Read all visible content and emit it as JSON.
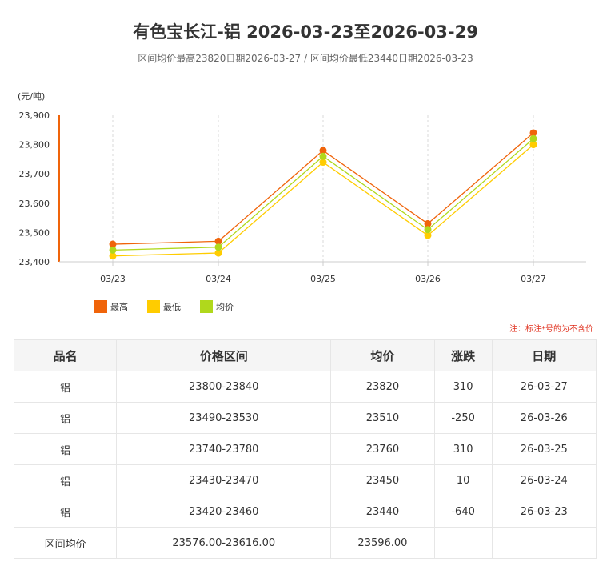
{
  "header": {
    "title": "有色宝长江-铝 2026-03-23至2026-03-29",
    "subtitle": "区间均价最高23820日期2026-03-27 / 区间均价最低23440日期2026-03-23"
  },
  "chart_data": {
    "type": "line",
    "categories": [
      "03/23",
      "03/24",
      "03/25",
      "03/26",
      "03/27"
    ],
    "series": [
      {
        "name": "最高",
        "color": "#f0640a",
        "values": [
          23460,
          23470,
          23780,
          23530,
          23840
        ]
      },
      {
        "name": "最低",
        "color": "#ffcc00",
        "values": [
          23420,
          23430,
          23740,
          23490,
          23800
        ]
      },
      {
        "name": "均价",
        "color": "#b0d81c",
        "values": [
          23440,
          23450,
          23760,
          23510,
          23820
        ]
      }
    ],
    "yunit": "(元/吨)",
    "ylim": [
      23400,
      23900
    ],
    "yticks": [
      23400,
      23500,
      23600,
      23700,
      23800,
      23900
    ],
    "ytick_labels": [
      "23,400",
      "23,500",
      "23,600",
      "23,700",
      "23,800",
      "23,900"
    ],
    "grid": "vertical dashed",
    "legend": "bottom-left"
  },
  "legend_items": [
    {
      "label": "最高",
      "color": "#f0640a"
    },
    {
      "label": "最低",
      "color": "#ffcc00"
    },
    {
      "label": "均价",
      "color": "#b0d81c"
    }
  ],
  "note": "注：标注*号的为不含价",
  "table": {
    "headers": [
      "品名",
      "价格区间",
      "均价",
      "涨跌",
      "日期"
    ],
    "rows": [
      [
        "铝",
        "23800-23840",
        "23820",
        "310",
        "26-03-27"
      ],
      [
        "铝",
        "23490-23530",
        "23510",
        "-250",
        "26-03-26"
      ],
      [
        "铝",
        "23740-23780",
        "23760",
        "310",
        "26-03-25"
      ],
      [
        "铝",
        "23430-23470",
        "23450",
        "10",
        "26-03-24"
      ],
      [
        "铝",
        "23420-23460",
        "23440",
        "-640",
        "26-03-23"
      ]
    ],
    "summary": {
      "label": "区间均价",
      "range": "23576.00-23616.00",
      "avg": "23596.00"
    }
  }
}
